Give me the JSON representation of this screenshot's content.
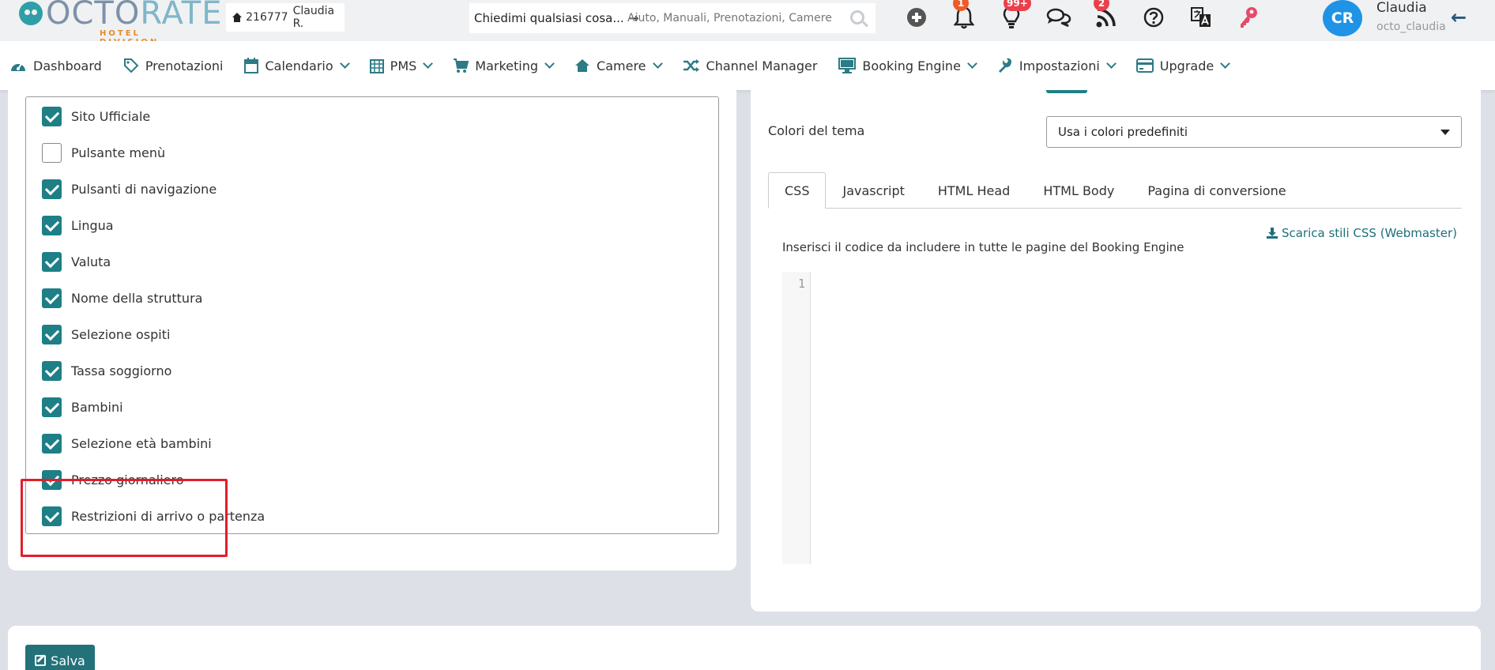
{
  "brand": {
    "logo_main": "OCTO",
    "logo_accent": "RATE",
    "logo_sub": "HOTEL DIVISION"
  },
  "header": {
    "hotel_id": "216777",
    "hotel_user": "Claudia R.",
    "ask_label": "Chiedimi qualsiasi cosa...",
    "search_placeholder": "Aiuto, Manuali, Prenotazioni, Camere ecc",
    "badges": {
      "notifications": "1",
      "ideas": "99+",
      "feeds": "2"
    },
    "avatar_initials": "CR",
    "user_name": "Claudia",
    "user_login": "octo_claudia"
  },
  "nav": {
    "dashboard": "Dashboard",
    "prenotazioni": "Prenotazioni",
    "calendario": "Calendario",
    "pms": "PMS",
    "marketing": "Marketing",
    "camere": "Camere",
    "channel_manager": "Channel Manager",
    "booking_engine": "Booking Engine",
    "impostazioni": "Impostazioni",
    "upgrade": "Upgrade"
  },
  "options": [
    {
      "label": "Sito Ufficiale",
      "checked": true
    },
    {
      "label": "Pulsante menù",
      "checked": false
    },
    {
      "label": "Pulsanti di navigazione",
      "checked": true
    },
    {
      "label": "Lingua",
      "checked": true
    },
    {
      "label": "Valuta",
      "checked": true
    },
    {
      "label": "Nome della struttura",
      "checked": true
    },
    {
      "label": "Selezione ospiti",
      "checked": true
    },
    {
      "label": "Tassa soggiorno",
      "checked": true
    },
    {
      "label": "Bambini",
      "checked": true
    },
    {
      "label": "Selezione età bambini",
      "checked": true
    },
    {
      "label": "Prezzo giornaliero",
      "checked": true
    },
    {
      "label": "Restrizioni di arrivo o partenza",
      "checked": true
    }
  ],
  "theme": {
    "label": "Colori del tema",
    "selected": "Usa i colori predefiniti"
  },
  "tabs": [
    {
      "label": "CSS",
      "active": true
    },
    {
      "label": "Javascript",
      "active": false
    },
    {
      "label": "HTML Head",
      "active": false
    },
    {
      "label": "HTML Body",
      "active": false
    },
    {
      "label": "Pagina di conversione",
      "active": false
    }
  ],
  "css_panel": {
    "download_link": "Scarica stili CSS (Webmaster)",
    "description": "Inserisci il codice da includere in tutte le pagine del Booking Engine",
    "line_number": "1"
  },
  "footer": {
    "save_label": "Salva"
  },
  "colors": {
    "teal": "#1e7f86",
    "avatar": "#1f93e6",
    "highlight": "#e01e2b",
    "badge": "#e9404b"
  }
}
